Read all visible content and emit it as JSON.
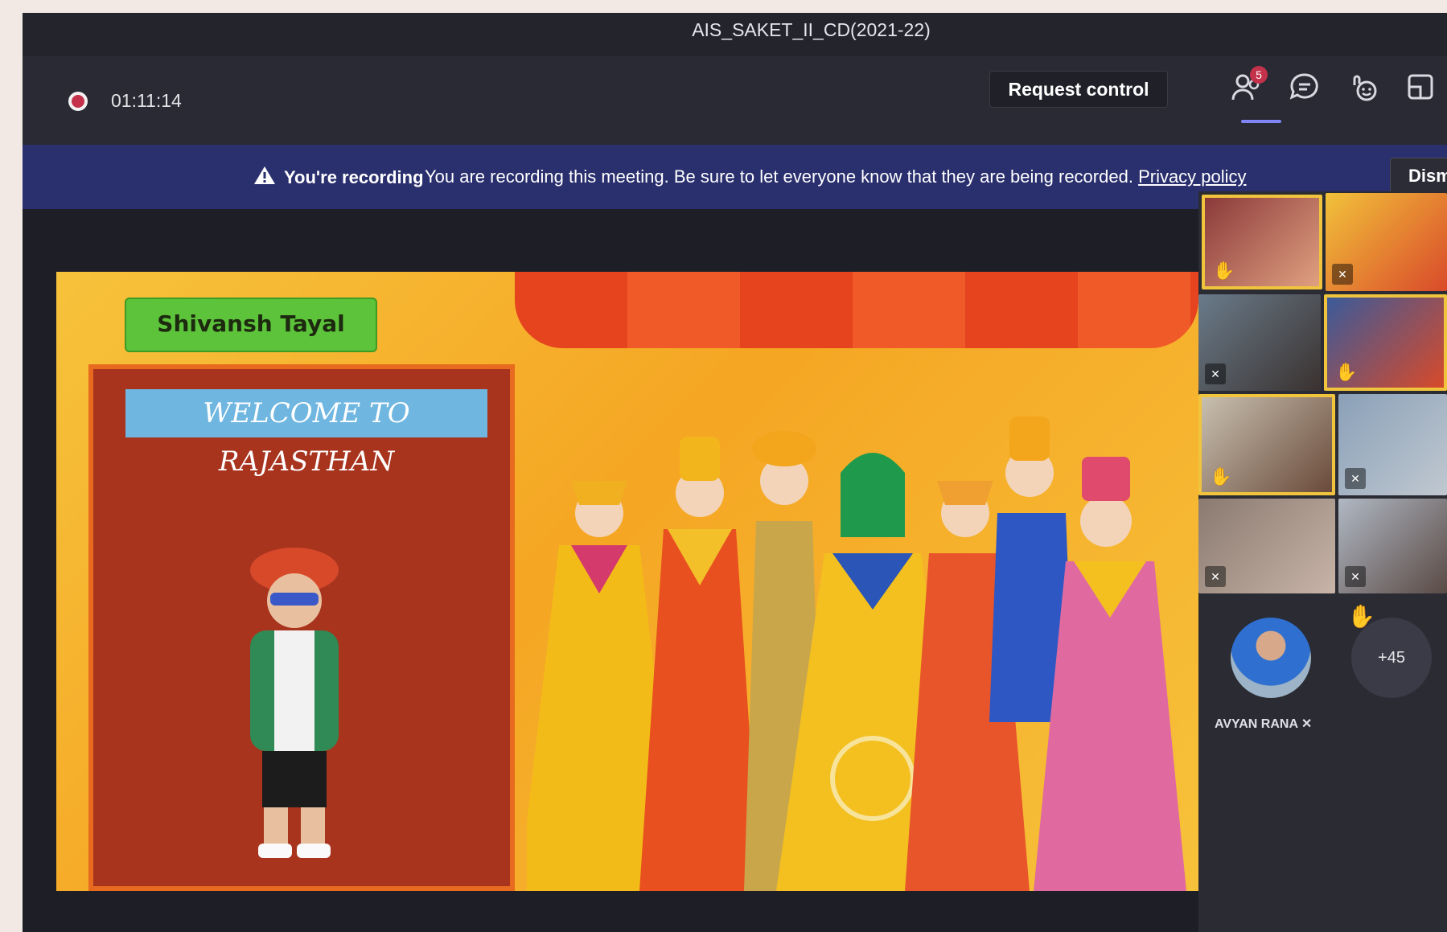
{
  "meeting": {
    "title": "AIS_SAKET_II_CD(2021-22)",
    "timer": "01:11:14"
  },
  "toolbar": {
    "request_control_label": "Request control",
    "participants_badge": "5",
    "icons": [
      "people-icon",
      "chat-icon",
      "reactions-icon",
      "breakout-rooms-icon"
    ]
  },
  "recording_banner": {
    "label": "You're recording",
    "message": "You are recording this meeting. Be sure to let everyone know that they are being recorded.",
    "link": "Privacy policy",
    "dismiss_label": "Dism"
  },
  "stage": {
    "presenter_name": "Shivansh Tayal",
    "photo_banner": "WELCOME TO RAJASTHAN"
  },
  "gallery": {
    "avatar_name": "AVYAN RANA",
    "more_count": "+45"
  },
  "colors": {
    "accent": "#7f85f5",
    "banner_bg": "#2a2f6e",
    "recording_red": "#c4314b",
    "raised_hand": "#f0c43c"
  }
}
